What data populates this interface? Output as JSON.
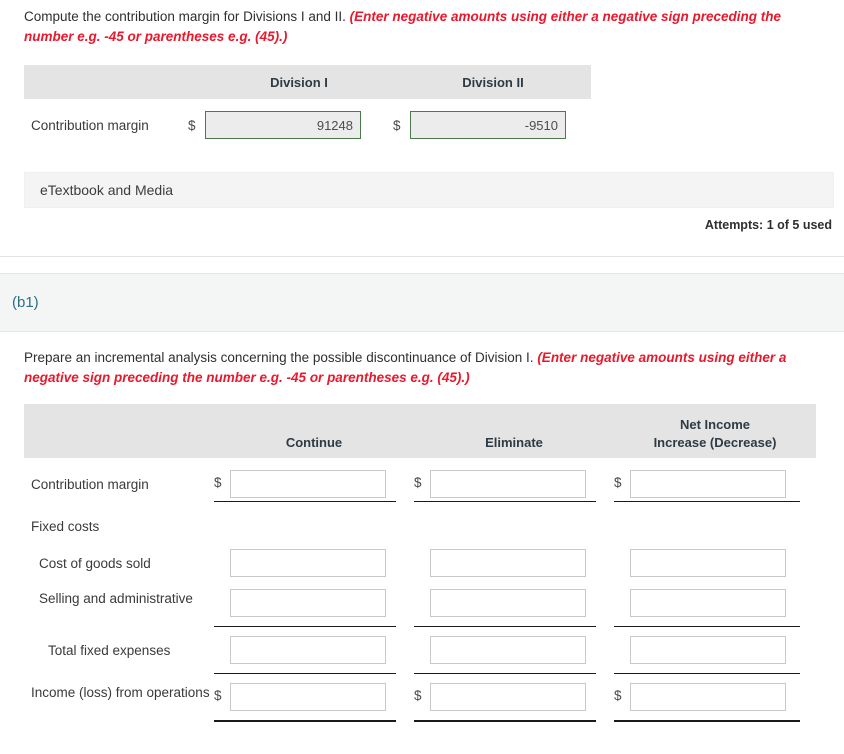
{
  "section_a": {
    "prompt_main": "Compute the contribution margin for Divisions I and II.",
    "prompt_hint": "(Enter negative amounts using either a negative sign preceding the number e.g. -45 or parentheses e.g. (45).)",
    "table": {
      "columns": [
        "Division I",
        "Division II"
      ],
      "rows": [
        {
          "label": "Contribution margin",
          "cells": [
            {
              "currency": "$",
              "value": "91248"
            },
            {
              "currency": "$",
              "value": "-9510"
            }
          ]
        }
      ]
    },
    "etextbook_label": "eTextbook and Media",
    "attempts_text": "Attempts: 1 of 5 used"
  },
  "section_b": {
    "badge": "(b1)",
    "prompt_main": "Prepare an incremental analysis concerning the possible discontinuance of Division I.",
    "prompt_hint": "(Enter negative amounts using either a negative sign preceding the number e.g. -45 or parentheses e.g. (45).)",
    "table": {
      "columns": [
        {
          "line1": "",
          "line2": "Continue"
        },
        {
          "line1": "",
          "line2": "Eliminate"
        },
        {
          "line1": "Net Income",
          "line2": "Increase (Decrease)"
        }
      ],
      "rows": [
        {
          "label": "Contribution margin",
          "indent": 0,
          "currency": "$",
          "values": [
            "",
            "",
            ""
          ]
        },
        {
          "label": "Fixed costs",
          "indent": 0,
          "currency": "",
          "values": [
            null,
            null,
            null
          ]
        },
        {
          "label": "Cost of goods sold",
          "indent": 1,
          "currency": "",
          "values": [
            "",
            "",
            ""
          ]
        },
        {
          "label": "Selling and administrative",
          "indent": 1,
          "currency": "",
          "values": [
            "",
            "",
            ""
          ]
        },
        {
          "label": "Total fixed expenses",
          "indent": 2,
          "currency": "",
          "values": [
            "",
            "",
            ""
          ]
        },
        {
          "label": "Income (loss) from operations",
          "indent": 0,
          "currency": "$",
          "values": [
            "",
            "",
            ""
          ]
        }
      ]
    }
  },
  "colors": {
    "hint_red": "#e8192c",
    "header_band": "#e4e4e4",
    "b1_band": "#f4f5f5",
    "b1_title": "#2d6e85",
    "filled_input_border": "#4a7a4a",
    "filled_input_bg": "#ececec",
    "empty_input_border": "#c9c9c9"
  }
}
